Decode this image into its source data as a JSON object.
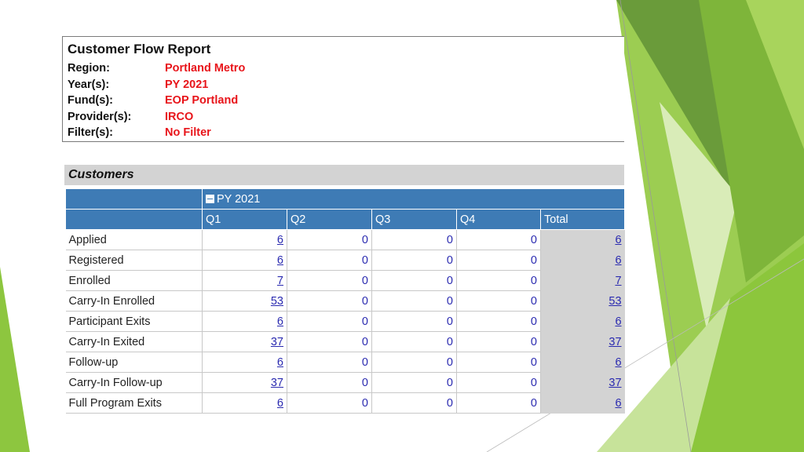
{
  "report": {
    "title": "Customer Flow Report",
    "meta": [
      {
        "label": "Region:",
        "value": "Portland Metro"
      },
      {
        "label": "Year(s):",
        "value": "PY 2021"
      },
      {
        "label": "Fund(s):",
        "value": "EOP Portland"
      },
      {
        "label": "Provider(s):",
        "value": "IRCO"
      },
      {
        "label": "Filter(s):",
        "value": "No Filter"
      }
    ]
  },
  "customers": {
    "section_title": "Customers",
    "year_group": "PY 2021",
    "columns": [
      "Q1",
      "Q2",
      "Q3",
      "Q4",
      "Total"
    ],
    "rows": [
      {
        "label": "Applied",
        "values": [
          "6",
          "0",
          "0",
          "0",
          "6"
        ]
      },
      {
        "label": "Registered",
        "values": [
          "6",
          "0",
          "0",
          "0",
          "6"
        ]
      },
      {
        "label": "Enrolled",
        "values": [
          "7",
          "0",
          "0",
          "0",
          "7"
        ]
      },
      {
        "label": "Carry-In Enrolled",
        "values": [
          "53",
          "0",
          "0",
          "0",
          "53"
        ]
      },
      {
        "label": "Participant Exits",
        "values": [
          "6",
          "0",
          "0",
          "0",
          "6"
        ]
      },
      {
        "label": "Carry-In Exited",
        "values": [
          "37",
          "0",
          "0",
          "0",
          "37"
        ]
      },
      {
        "label": "Follow-up",
        "values": [
          "6",
          "0",
          "0",
          "0",
          "6"
        ]
      },
      {
        "label": "Carry-In Follow-up",
        "values": [
          "37",
          "0",
          "0",
          "0",
          "37"
        ]
      },
      {
        "label": "Full Program Exits",
        "values": [
          "6",
          "0",
          "0",
          "0",
          "6"
        ]
      }
    ]
  },
  "colors": {
    "header_blue": "#3e7bb5",
    "meta_red": "#e8141a",
    "link_blue": "#2a2ab0",
    "total_gray": "#d3d3d3",
    "accent_green": "#8dc63f"
  }
}
